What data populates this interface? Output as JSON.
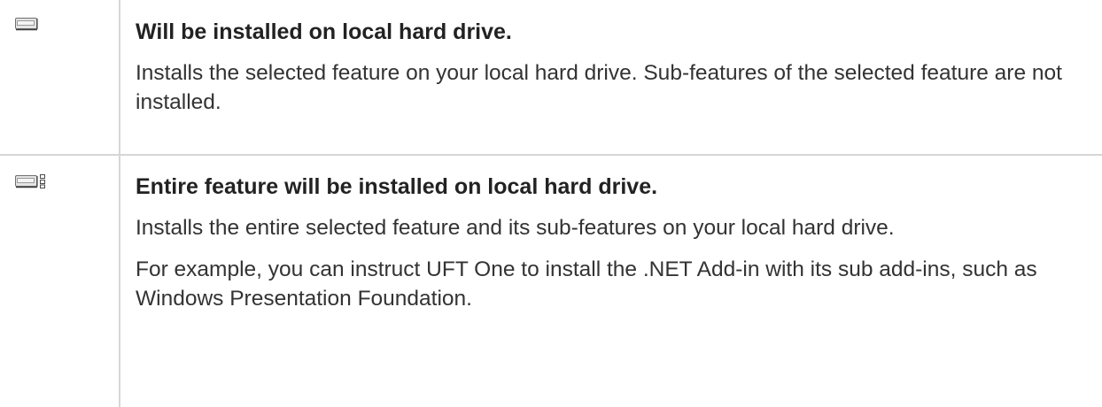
{
  "rows": [
    {
      "icon": "hard-drive-icon",
      "title": "Will be installed on local hard drive.",
      "paragraphs": [
        "Installs the selected feature on your local hard drive. Sub-features of the selected feature are not installed."
      ]
    },
    {
      "icon": "hard-drive-entire-feature-icon",
      "title": "Entire feature will be installed on local hard drive.",
      "paragraphs": [
        "Installs the entire selected feature and its sub-features on your local hard drive.",
        "For example, you can instruct UFT One to install the .NET Add-in with its sub add-ins, such as Windows Presentation Foundation."
      ]
    }
  ],
  "colors": {
    "border": "#d6d6d6",
    "text": "#333333"
  }
}
